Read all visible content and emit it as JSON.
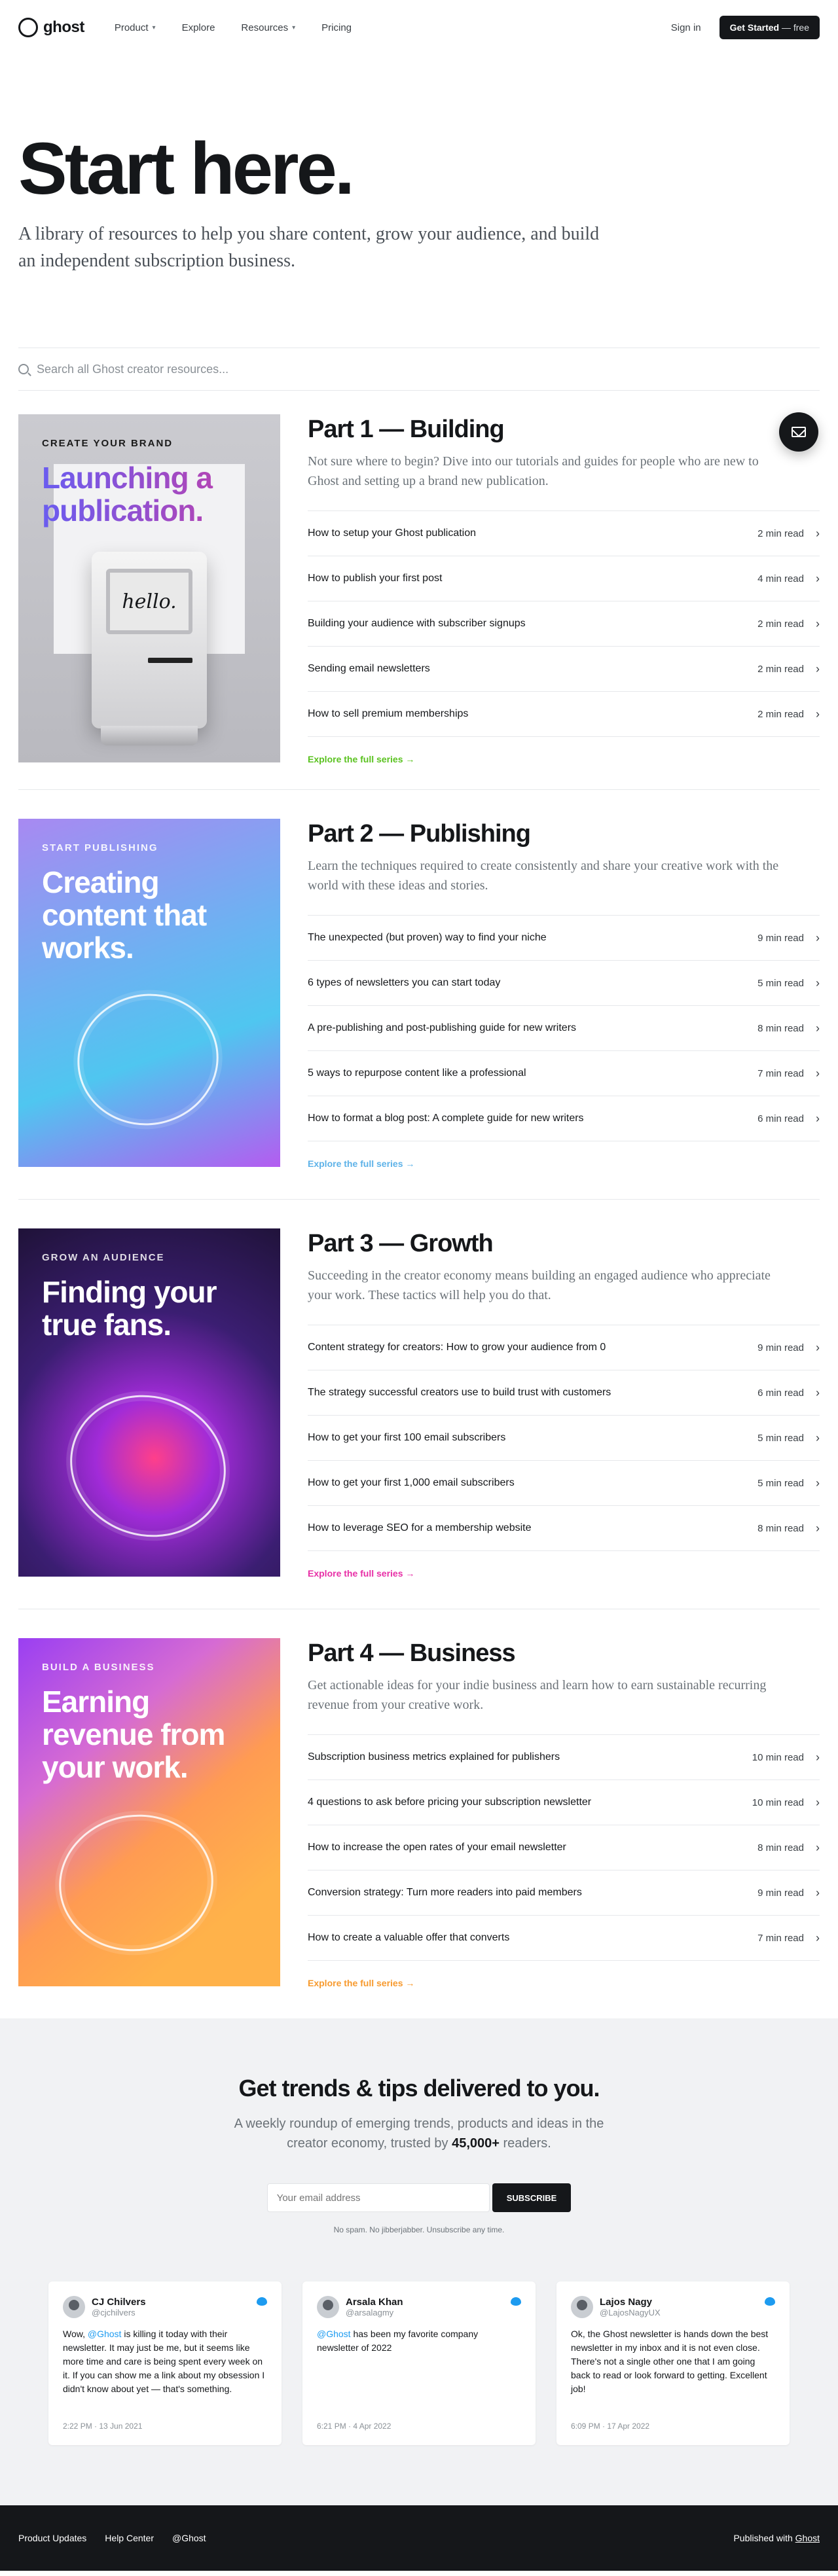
{
  "nav": {
    "logo_text": "ghost",
    "links": [
      "Product",
      "Explore",
      "Resources",
      "Pricing"
    ],
    "sign_in": "Sign in",
    "cta_main": "Get Started",
    "cta_suffix": "— free"
  },
  "hero": {
    "title": "Start here.",
    "subtitle": "A library of resources to help you share content, grow your audience, and build an independent subscription business."
  },
  "search": {
    "placeholder": "Search all Ghost creator resources..."
  },
  "parts": [
    {
      "kicker": "Create your brand",
      "headline": "Launching a publication.",
      "screen_text": "hello.",
      "title": "Part 1 — Building",
      "desc": "Not sure where to begin? Dive into our tutorials and guides for people who are new to Ghost and setting up a brand new publication.",
      "accent": "#5ac21f",
      "items": [
        {
          "title": "How to setup your Ghost publication",
          "time": "2 min read"
        },
        {
          "title": "How to publish your first post",
          "time": "4 min read"
        },
        {
          "title": "Building your audience with subscriber signups",
          "time": "2 min read"
        },
        {
          "title": "Sending email newsletters",
          "time": "2 min read"
        },
        {
          "title": "How to sell premium memberships",
          "time": "2 min read"
        }
      ],
      "explore": "Explore the full series →"
    },
    {
      "kicker": "Start publishing",
      "headline": "Creating content that works.",
      "title": "Part 2 — Publishing",
      "desc": "Learn the techniques required to create consistently and share your creative work with the world with these ideas and stories.",
      "accent": "#5db2e8",
      "items": [
        {
          "title": "The unexpected (but proven) way to find your niche",
          "time": "9 min read"
        },
        {
          "title": "6 types of newsletters you can start today",
          "time": "5 min read"
        },
        {
          "title": "A pre-publishing and post-publishing guide for new writers",
          "time": "8 min read"
        },
        {
          "title": "5 ways to repurpose content like a professional",
          "time": "7 min read"
        },
        {
          "title": "How to format a blog post: A complete guide for new writers",
          "time": "6 min read"
        }
      ],
      "explore": "Explore the full series →"
    },
    {
      "kicker": "Grow an audience",
      "headline": "Finding your true fans.",
      "title": "Part 3 — Growth",
      "desc": "Succeeding in the creator economy means building an engaged audience who appreciate your work. These tactics will help you do that.",
      "accent": "#e72fa6",
      "items": [
        {
          "title": "Content strategy for creators: How to grow your audience from 0",
          "time": "9 min read"
        },
        {
          "title": "The strategy successful creators use to build trust with customers",
          "time": "6 min read"
        },
        {
          "title": "How to get your first 100 email subscribers",
          "time": "5 min read"
        },
        {
          "title": "How to get your first 1,000 email subscribers",
          "time": "5 min read"
        },
        {
          "title": "How to leverage SEO for a membership website",
          "time": "8 min read"
        }
      ],
      "explore": "Explore the full series →"
    },
    {
      "kicker": "Build a business",
      "headline": "Earning revenue from your work.",
      "title": "Part 4 — Business",
      "desc": "Get actionable ideas for your indie business and learn how to earn sustainable recurring revenue from your creative work.",
      "accent": "#f79a2e",
      "items": [
        {
          "title": "Subscription business metrics explained for publishers",
          "time": "10 min read"
        },
        {
          "title": "4 questions to ask before pricing your subscription newsletter",
          "time": "10 min read"
        },
        {
          "title": "How to increase the open rates of your email newsletter",
          "time": "8 min read"
        },
        {
          "title": "Conversion strategy: Turn more readers into paid members",
          "time": "9 min read"
        },
        {
          "title": "How to create a valuable offer that converts",
          "time": "7 min read"
        }
      ],
      "explore": "Explore the full series →"
    }
  ],
  "newsletter": {
    "title": "Get trends & tips delivered to you.",
    "sub_before": "A weekly roundup of emerging trends, products and ideas in the creator economy, trusted by ",
    "sub_bold": "45,000+",
    "sub_after": " readers.",
    "placeholder": "Your email address",
    "button": "SUBSCRIBE",
    "fine": "No spam. No jibberjabber. Unsubscribe any time."
  },
  "tweets": [
    {
      "name": "CJ Chilvers",
      "handle": "@cjchilvers",
      "pre": "Wow, ",
      "mention": "@Ghost",
      "post": " is killing it today with their newsletter. It may just be me, but it seems like more time and care is being spent every week on it. If you can show me a link about my obsession I didn't know about yet — that's something.",
      "date": "2:22 PM · 13 Jun 2021"
    },
    {
      "name": "Arsala Khan",
      "handle": "@arsalagmy",
      "pre": "",
      "mention": "@Ghost",
      "post": " has been my favorite company newsletter of 2022",
      "date": "6:21 PM · 4 Apr 2022"
    },
    {
      "name": "Lajos Nagy",
      "handle": "@LajosNagyUX",
      "pre": "",
      "mention": "",
      "post": "Ok, the Ghost newsletter is hands down the best newsletter in my inbox and it is not even close. There's not a single other one that I am going back to read or look forward to getting. Excellent job!",
      "date": "6:09 PM · 17 Apr 2022"
    }
  ],
  "footer": {
    "links": [
      "Product Updates",
      "Help Center",
      "@Ghost"
    ],
    "published_prefix": "Published with ",
    "published_link": "Ghost"
  }
}
